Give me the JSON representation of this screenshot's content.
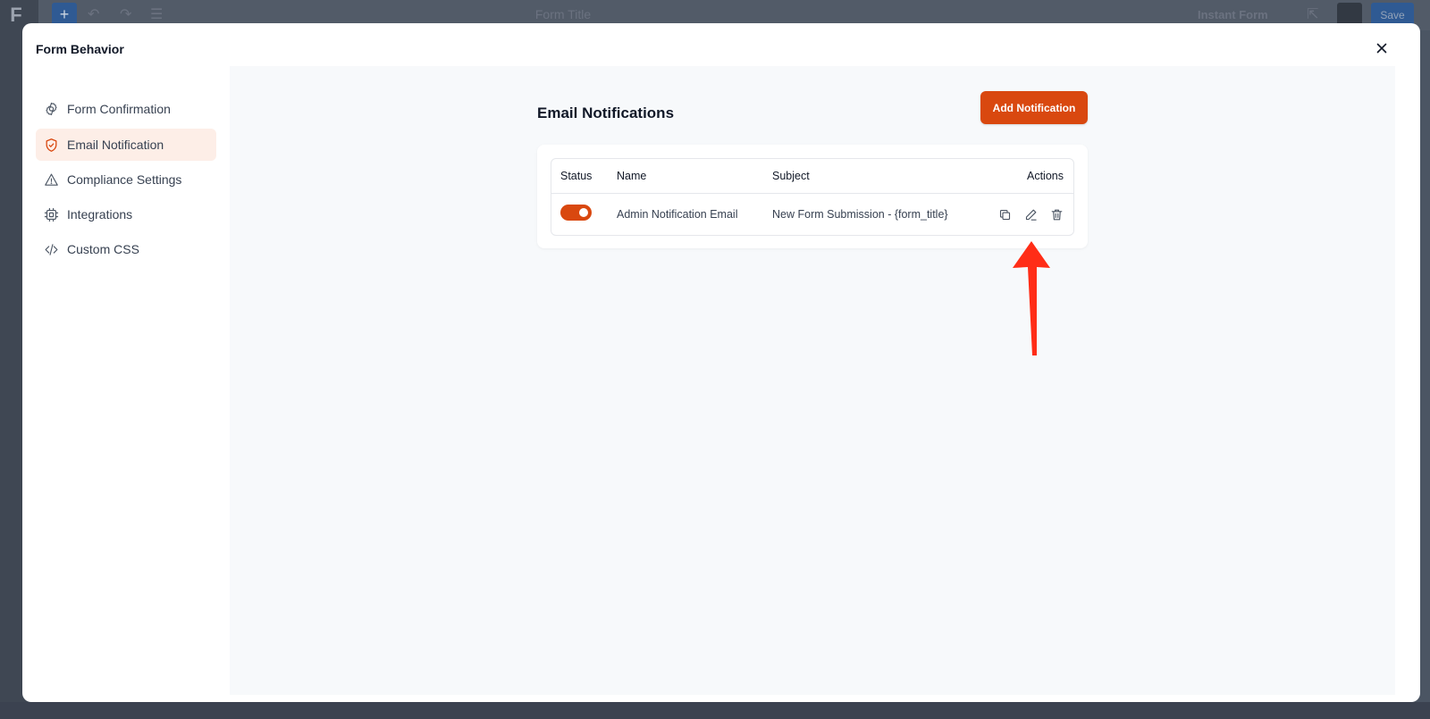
{
  "background": {
    "logo": "F",
    "title": "Form Title",
    "instant_form": "Instant Form",
    "save": "Save"
  },
  "modal": {
    "title": "Form Behavior"
  },
  "sidebar": {
    "items": [
      {
        "label": "Form Confirmation",
        "icon": "gear-icon",
        "active": false
      },
      {
        "label": "Email Notification",
        "icon": "shield-check-icon",
        "active": true
      },
      {
        "label": "Compliance Settings",
        "icon": "warning-triangle-icon",
        "active": false
      },
      {
        "label": "Integrations",
        "icon": "chip-icon",
        "active": false
      },
      {
        "label": "Custom CSS",
        "icon": "code-icon",
        "active": false
      }
    ]
  },
  "main": {
    "title": "Email Notifications",
    "add_button": "Add Notification",
    "table": {
      "headers": {
        "status": "Status",
        "name": "Name",
        "subject": "Subject",
        "actions": "Actions"
      },
      "rows": [
        {
          "status_on": true,
          "name": "Admin Notification Email",
          "subject": "New Form Submission - {form_title}"
        }
      ]
    }
  },
  "colors": {
    "accent": "#d9480f",
    "active_bg": "#fdeee7",
    "annotation": "#ff2d17"
  }
}
